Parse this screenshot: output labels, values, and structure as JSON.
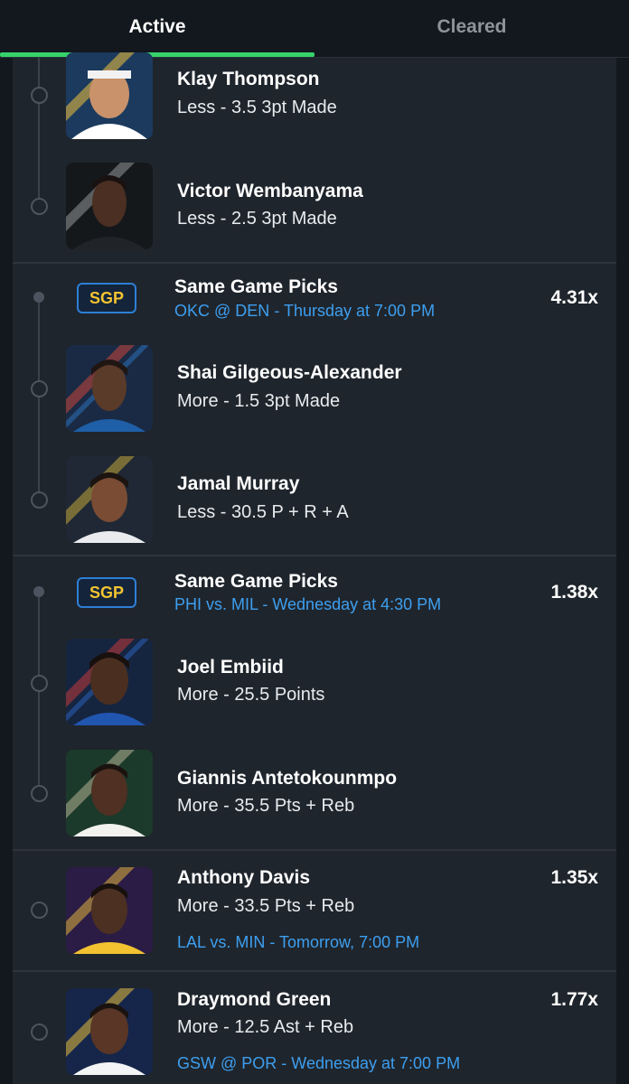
{
  "tabs": {
    "active": "Active",
    "cleared": "Cleared"
  },
  "colors": {
    "accent": "#35d36a",
    "link": "#3d9ff0",
    "badge_text": "#f4c430",
    "card": "#1f252c",
    "background": "#13181e"
  },
  "entries": {
    "klay": {
      "name": "Klay Thompson",
      "pick": "Less - 3.5 3pt Made"
    },
    "wemby": {
      "name": "Victor Wembanyama",
      "pick": "Less - 2.5 3pt Made"
    },
    "sgp1": {
      "badge": "SGP",
      "title": "Same Game Picks",
      "matchup": "OKC @ DEN",
      "time": "- Thursday at 7:00 PM",
      "multiplier": "4.31x"
    },
    "shai": {
      "name": "Shai Gilgeous-Alexander",
      "pick": "More - 1.5 3pt Made"
    },
    "murray": {
      "name": "Jamal Murray",
      "pick": "Less - 30.5 P + R + A"
    },
    "sgp2": {
      "badge": "SGP",
      "title": "Same Game Picks",
      "matchup": "PHI vs. MIL",
      "time": "- Wednesday at 4:30 PM",
      "multiplier": "1.38x"
    },
    "embiid": {
      "name": "Joel Embiid",
      "pick": "More - 25.5 Points"
    },
    "giannis": {
      "name": "Giannis Antetokounmpo",
      "pick": "More - 35.5 Pts + Reb"
    },
    "davis": {
      "name": "Anthony Davis",
      "pick": "More - 33.5 Pts + Reb",
      "matchup": "LAL vs. MIN",
      "time": "- Tomorrow, 7:00 PM",
      "multiplier": "1.35x"
    },
    "draymond": {
      "name": "Draymond Green",
      "pick": "More - 12.5 Ast + Reb",
      "matchup": "GSW @ POR",
      "time": "- Wednesday at 7:00 PM",
      "multiplier": "1.77x"
    }
  }
}
